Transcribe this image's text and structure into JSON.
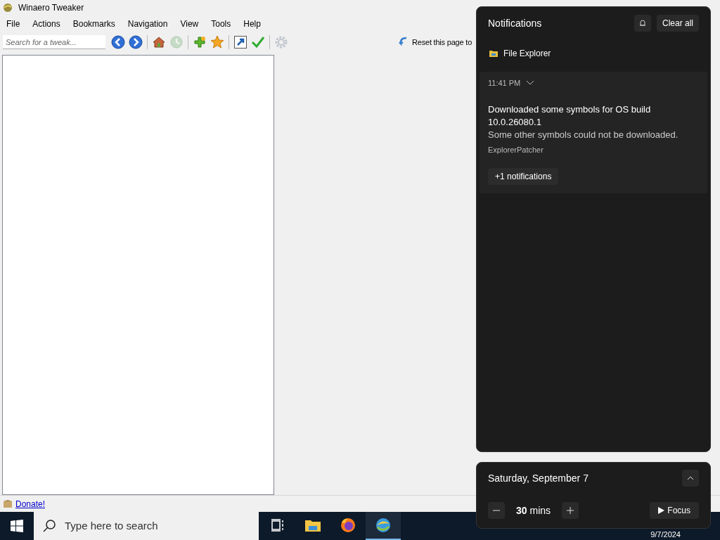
{
  "window": {
    "title": "Winaero Tweaker"
  },
  "menu": [
    "File",
    "Actions",
    "Bookmarks",
    "Navigation",
    "View",
    "Tools",
    "Help"
  ],
  "search": {
    "placeholder": "Search for a tweak..."
  },
  "toolbar": [
    {
      "kind": "back",
      "disabled": false
    },
    {
      "kind": "forward",
      "disabled": false
    },
    {
      "kind": "home",
      "disabled": false
    },
    {
      "kind": "history",
      "disabled": true
    },
    {
      "kind": "add-bookmark",
      "disabled": false
    },
    {
      "kind": "bookmarks",
      "disabled": false
    },
    {
      "kind": "shortcut",
      "disabled": false
    },
    {
      "kind": "apply",
      "disabled": false
    },
    {
      "kind": "settings",
      "disabled": true
    }
  ],
  "reset_button": "Reset this page to",
  "status_bar": {
    "link": "Donate!"
  },
  "taskbar": {
    "search_placeholder": "Type here to search",
    "apps": [
      {
        "kind": "task-view",
        "active": false
      },
      {
        "kind": "folder",
        "active": false
      },
      {
        "kind": "browser",
        "active": false
      },
      {
        "kind": "tweaker",
        "active": true
      }
    ],
    "date": "9/7/2024"
  },
  "notifications": {
    "title": "Notifications",
    "clear_all": "Clear all",
    "groups": [
      {
        "app": "File Explorer",
        "time": "11:41 PM",
        "title": "Downloaded some symbols for OS build 10.0.26080.1",
        "body": "Some other symbols could not be downloaded.",
        "source": "ExplorerPatcher",
        "more": "+1 notifications"
      }
    ]
  },
  "calendar": {
    "date": "Saturday, September 7",
    "minutes": "30",
    "unit": "mins",
    "focus": "Focus"
  }
}
